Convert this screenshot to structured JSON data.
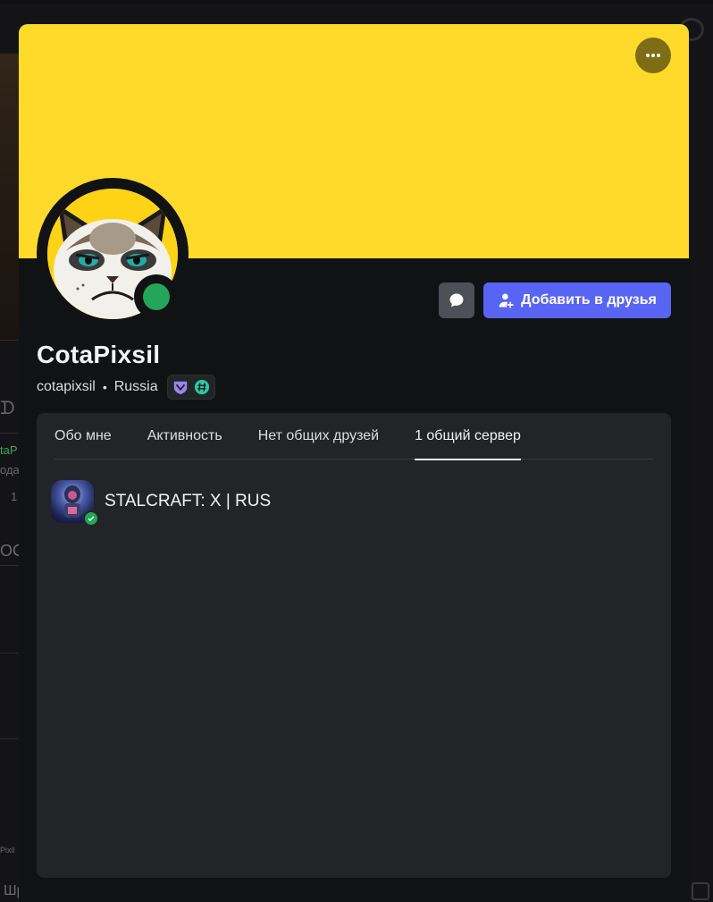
{
  "background": {
    "fragments": [
      "ᗪ",
      "taP",
      "ода",
      "1",
      "OC",
      "Pixil",
      "Шр"
    ]
  },
  "profile": {
    "display_name": "CotaPixsil",
    "username": "cotapixsil",
    "location": "Russia",
    "banner_color": "#ffda2a",
    "status": "online",
    "status_color": "#23a55a",
    "badges": [
      {
        "name": "hypesquad-balance-badge",
        "color": "#9b84ee"
      },
      {
        "name": "hashtag-badge",
        "color": "#2dc7a0"
      }
    ]
  },
  "actions": {
    "more_icon": "more-horizontal-icon",
    "message_icon": "chat-bubble-icon",
    "add_friend_label": "Добавить в друзья",
    "add_friend_icon": "add-user-icon",
    "accent": "#5865f2"
  },
  "tabs": [
    {
      "label": "Обо мне",
      "active": false
    },
    {
      "label": "Активность",
      "active": false
    },
    {
      "label": "Нет общих друзей",
      "active": false
    },
    {
      "label": "1 общий сервер",
      "active": true
    }
  ],
  "mutual_servers": [
    {
      "name": "STALCRAFT: X | RUS",
      "verified": true
    }
  ]
}
